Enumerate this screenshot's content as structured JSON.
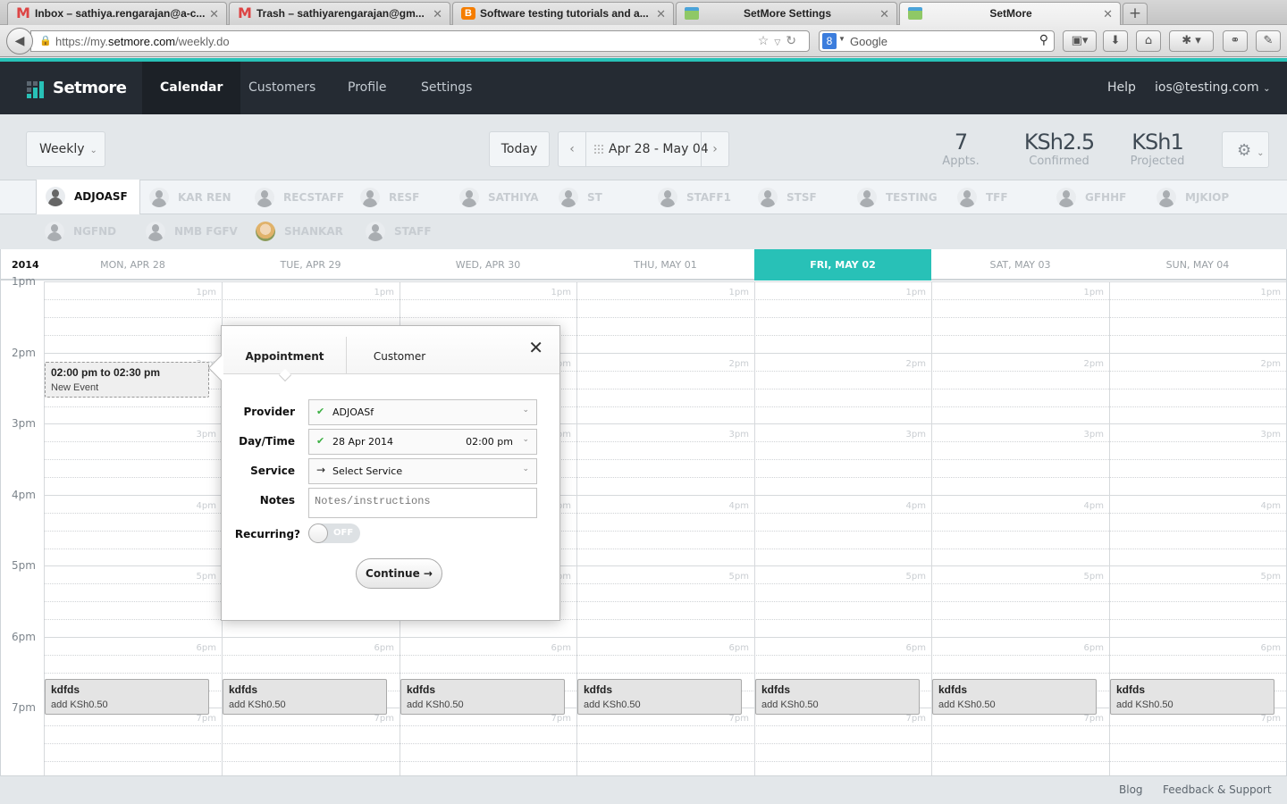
{
  "browser": {
    "tabs": [
      {
        "title": "Inbox – sathiya.rengarajan@a-c...",
        "icon": "gmail-icon",
        "active": false
      },
      {
        "title": "Trash – sathiyarengarajan@gm...",
        "icon": "gmail-icon",
        "active": false
      },
      {
        "title": "Software testing tutorials and a...",
        "icon": "blogger-icon",
        "active": false
      },
      {
        "title": "SetMore Settings",
        "icon": "setmore-calendar-icon",
        "active": false
      },
      {
        "title": "SetMore",
        "icon": "setmore-calendar-icon",
        "active": true
      }
    ],
    "new_tab_label": "+",
    "url_prefix": "https://my.",
    "url_host": "setmore.com",
    "url_path": "/weekly.do",
    "search_placeholder": "Google",
    "search_engine_glyph": "8"
  },
  "app": {
    "brand": "Setmore",
    "nav": [
      {
        "label": "Calendar",
        "active": true
      },
      {
        "label": "Customers",
        "active": false
      },
      {
        "label": "Profile",
        "active": false
      },
      {
        "label": "Settings",
        "active": false
      }
    ],
    "help_label": "Help",
    "account_email": "ios@testing.com",
    "accent_color": "#28c1b7",
    "header_bg": "#252b33"
  },
  "toolbar": {
    "view_select": "Weekly",
    "today_label": "Today",
    "date_range": "Apr 28 - May 04",
    "stats": [
      {
        "value": "7",
        "label": "Appts."
      },
      {
        "value": "KSh2.5",
        "label": "Confirmed"
      },
      {
        "value": "KSh1",
        "label": "Projected"
      }
    ]
  },
  "staff": {
    "row1": [
      {
        "name": "ADJOASF",
        "selected": true,
        "photo": false
      },
      {
        "name": "KAR REN",
        "selected": false,
        "photo": false
      },
      {
        "name": "RECSTAFF",
        "selected": false,
        "photo": false
      },
      {
        "name": "RESF",
        "selected": false,
        "photo": false
      },
      {
        "name": "SATHIYA",
        "selected": false,
        "photo": false
      },
      {
        "name": "ST",
        "selected": false,
        "photo": false
      },
      {
        "name": "STAFF1",
        "selected": false,
        "photo": false
      },
      {
        "name": "STSF",
        "selected": false,
        "photo": false
      },
      {
        "name": "TESTING",
        "selected": false,
        "photo": false
      },
      {
        "name": "TFF",
        "selected": false,
        "photo": false
      },
      {
        "name": "GFHHF",
        "selected": false,
        "photo": false
      },
      {
        "name": "MJKIOP",
        "selected": false,
        "photo": false
      }
    ],
    "row2": [
      {
        "name": "NGFND",
        "selected": false,
        "photo": false
      },
      {
        "name": "NMB FGFV",
        "selected": false,
        "photo": false
      },
      {
        "name": "SHANKAR",
        "selected": false,
        "photo": true
      },
      {
        "name": "STAFF",
        "selected": false,
        "photo": false
      }
    ]
  },
  "calendar": {
    "year": "2014",
    "days": [
      {
        "label": "MON, APR 28",
        "today": false
      },
      {
        "label": "TUE, APR 29",
        "today": false
      },
      {
        "label": "WED, APR 30",
        "today": false
      },
      {
        "label": "THU, MAY 01",
        "today": false
      },
      {
        "label": "FRI, MAY 02",
        "today": true
      },
      {
        "label": "SAT, MAY 03",
        "today": false
      },
      {
        "label": "SUN, MAY 04",
        "today": false
      }
    ],
    "hours": [
      "1pm",
      "2pm",
      "3pm",
      "4pm",
      "5pm",
      "6pm",
      "7pm"
    ],
    "new_event": {
      "time": "02:00 pm to 02:30 pm",
      "title": "New Event",
      "day_index": 0
    },
    "events": [
      {
        "day_index": 0,
        "title": "kdfds",
        "subtitle": "add KSh0.50"
      },
      {
        "day_index": 1,
        "title": "kdfds",
        "subtitle": "add KSh0.50"
      },
      {
        "day_index": 2,
        "title": "kdfds",
        "subtitle": "add KSh0.50"
      },
      {
        "day_index": 3,
        "title": "kdfds",
        "subtitle": "add KSh0.50"
      },
      {
        "day_index": 4,
        "title": "kdfds",
        "subtitle": "add KSh0.50"
      },
      {
        "day_index": 5,
        "title": "kdfds",
        "subtitle": "add KSh0.50"
      },
      {
        "day_index": 6,
        "title": "kdfds",
        "subtitle": "add KSh0.50"
      }
    ]
  },
  "popup": {
    "tabs": [
      {
        "label": "Appointment",
        "active": true
      },
      {
        "label": "Customer",
        "active": false
      }
    ],
    "close_glyph": "✕",
    "provider_label": "Provider",
    "provider_value": "ADJOASf",
    "daytime_label": "Day/Time",
    "date_value": "28 Apr 2014",
    "time_value": "02:00 pm",
    "service_label": "Service",
    "service_value": "Select Service",
    "notes_label": "Notes",
    "notes_placeholder": "Notes/instructions",
    "notes_value": "",
    "recurring_label": "Recurring?",
    "recurring_state": "OFF",
    "continue_label": "Continue →"
  },
  "footer": {
    "blog_label": "Blog",
    "feedback_label": "Feedback & Support"
  }
}
